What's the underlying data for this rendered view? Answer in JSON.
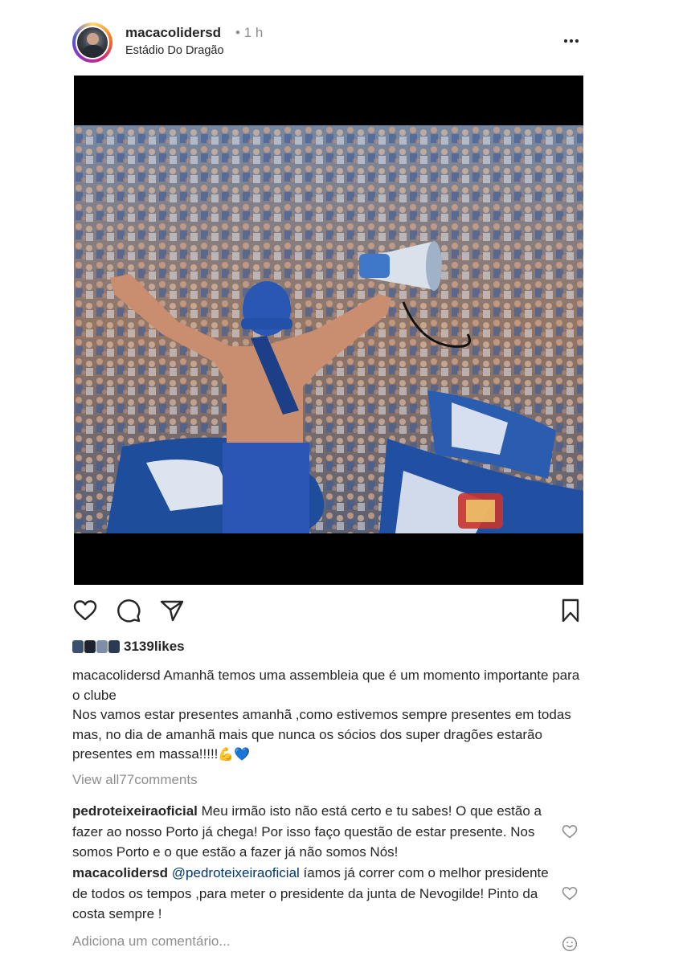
{
  "post": {
    "username": "macacolidersd",
    "time": "• 1 h",
    "location": "Estádio Do Dragão"
  },
  "likes": {
    "count": "3139",
    "suffix": "likes"
  },
  "caption": {
    "username": "macacolidersd",
    "line1": "Amanhã temos uma assembleia que é um momento importante para o clube",
    "line2": "Nos vamos estar presentes amanhã ,como estivemos sempre presentes em todas mas, no dia de amanhã mais que nunca os sócios dos super dragões estarão presentes em massa!!!!!",
    "emojis": "💪💙"
  },
  "view_all": {
    "prefix": "View all",
    "count": "77",
    "suffix": "comments"
  },
  "comments": [
    {
      "username": "pedroteixeiraoficial",
      "text": "Meu irmão isto não está certo e tu sabes! O que estão a fazer ao nosso Porto já chega! Por isso faço questão de estar presente. Nos somos Porto e o que estão a fazer já não somos Nós!"
    },
    {
      "username": "macacolidersd",
      "mention": "@pedroteixeiraoficial",
      "text": "íamos já correr com o melhor presidente de todos os tempos ,para meter o presidente da junta de Nevogilde! Pinto da costa sempre !"
    }
  ],
  "add_comment_placeholder": "Adiciona um comentário...",
  "colors": {
    "text": "#262626",
    "muted": "#8e8e8e",
    "mention": "#00376b",
    "porto_blue": "#1f4fa8"
  },
  "icons": [
    "more-icon",
    "heart-icon",
    "comment-icon",
    "share-icon",
    "bookmark-icon",
    "emoji-icon"
  ]
}
